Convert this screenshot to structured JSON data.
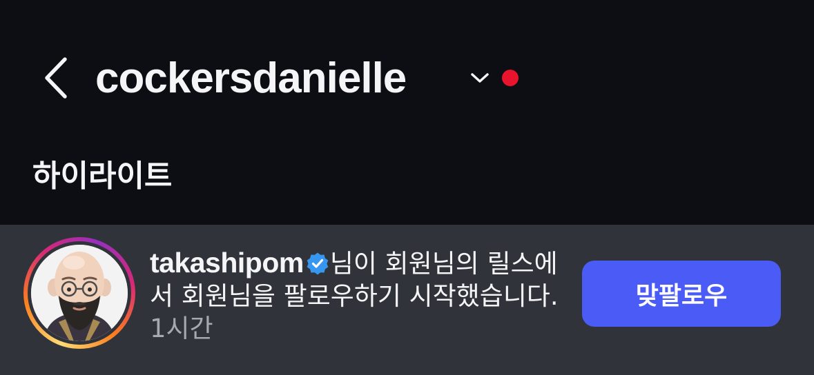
{
  "header": {
    "back_icon": "chevron-left-icon",
    "username": "cockersdanielle",
    "dropdown_icon": "chevron-down-icon",
    "status_dot_color": "#e8132c"
  },
  "highlights": {
    "title": "하이라이트"
  },
  "notification": {
    "avatar_icon": "memoji-avatar",
    "username": "takashipom",
    "verified_icon": "verified-badge-icon",
    "message": "님이 회원님의 릴스에서 회원님을 팔로우하기 시작했습니다.",
    "time": "1시간",
    "follow_back_label": "맞팔로우",
    "button_color": "#4a5cf5",
    "verified_color": "#3797f0"
  }
}
